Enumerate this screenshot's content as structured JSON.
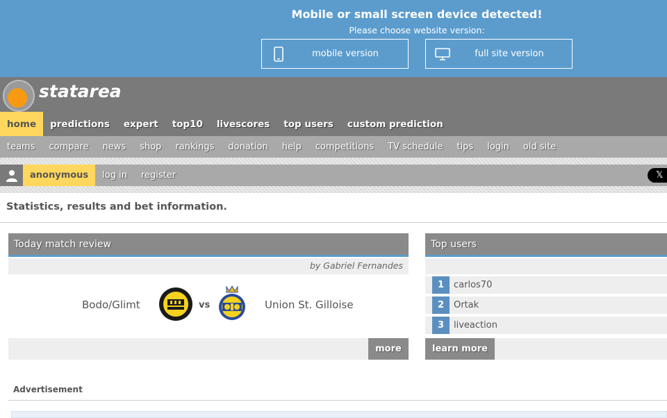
{
  "banner": {
    "title": "Mobile or small screen device detected!",
    "subtitle": "Please choose website version:",
    "mobile_label": "mobile version",
    "full_label": "full site version"
  },
  "header": {
    "logo_text": "statarea"
  },
  "main_nav": [
    "home",
    "predictions",
    "expert",
    "top10",
    "livescores",
    "top users",
    "custom prediction"
  ],
  "sub_nav": [
    "teams",
    "compare",
    "news",
    "shop",
    "rankings",
    "donation",
    "help",
    "competitions",
    "TV schedule",
    "tips",
    "login",
    "old site"
  ],
  "user_bar": {
    "username": "anonymous",
    "login": "log in",
    "register": "register",
    "x_label": "𝕏"
  },
  "tagline": "Statistics, results and bet information.",
  "match_review": {
    "title": "Today match review",
    "byline": "by Gabriel Fernandes",
    "home_team": "Bodo/Glimt",
    "vs": "vs",
    "away_team": "Union St. Gilloise",
    "more": "more"
  },
  "top_users": {
    "title": "Top users",
    "users": [
      {
        "rank": "1",
        "name": "carlos70"
      },
      {
        "rank": "2",
        "name": "Ortak"
      },
      {
        "rank": "3",
        "name": "liveaction"
      }
    ],
    "learn_more": "learn more"
  },
  "advertisement_label": "Advertisement",
  "colors": {
    "accent_blue": "#5b9ccd",
    "nav_gray": "#7a7a7a",
    "active_yellow": "#ffd75e",
    "logo_orange": "#f79a12"
  }
}
